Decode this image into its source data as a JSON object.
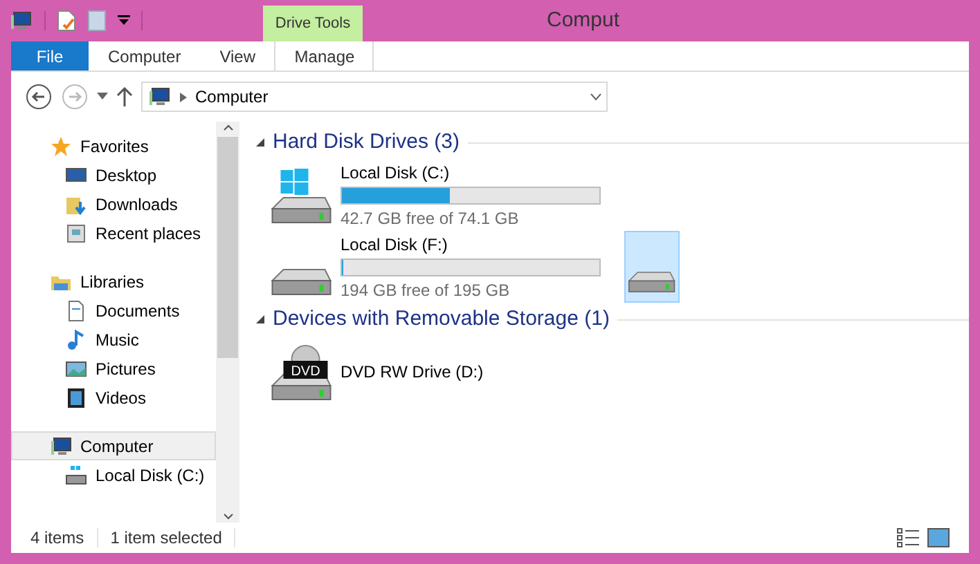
{
  "window": {
    "title": "Comput"
  },
  "context_tab": {
    "label": "Drive Tools"
  },
  "tabs": [
    {
      "label": "File",
      "kind": "file",
      "selected": false
    },
    {
      "label": "Computer",
      "kind": "tab",
      "selected": false
    },
    {
      "label": "View",
      "kind": "tab",
      "selected": false
    },
    {
      "label": "Manage",
      "kind": "context",
      "selected": false
    }
  ],
  "address": {
    "path": "Computer"
  },
  "sidebar": {
    "items": [
      {
        "label": "Favorites",
        "kind": "star",
        "selected": false,
        "children": [
          {
            "label": "Desktop",
            "kind": "desktop",
            "selected": false
          },
          {
            "label": "Downloads",
            "kind": "downloads",
            "selected": false
          },
          {
            "label": "Recent places",
            "kind": "recent",
            "selected": false
          }
        ]
      },
      {
        "label": "Libraries",
        "kind": "library",
        "selected": false,
        "children": [
          {
            "label": "Documents",
            "kind": "document",
            "selected": false
          },
          {
            "label": "Music",
            "kind": "music",
            "selected": false
          },
          {
            "label": "Pictures",
            "kind": "picture",
            "selected": false
          },
          {
            "label": "Videos",
            "kind": "video",
            "selected": false
          }
        ]
      },
      {
        "label": "Computer",
        "kind": "computer",
        "selected": true,
        "children": [
          {
            "label": "Local Disk (C:)",
            "kind": "disk",
            "selected": false
          }
        ]
      }
    ]
  },
  "groups": [
    {
      "title": "Hard Disk Drives (3)",
      "expanded": true,
      "drives": [
        {
          "kind": "system",
          "name": "Local Disk (C:)",
          "level": 0.42,
          "reading": "42.7 GB free of 74.1 GB",
          "selected": false
        },
        {
          "kind": "disk",
          "name": "Local Disk (F:)",
          "level": 0.005,
          "reading": "194 GB free of 195 GB",
          "selected": false
        },
        {
          "kind": "disk",
          "selected": true
        }
      ]
    },
    {
      "title": "Devices with Removable Storage (1)",
      "expanded": true,
      "drives": [
        {
          "kind": "dvd",
          "name": "DVD RW Drive (D:)",
          "icon_text": "DVD",
          "selected": false
        }
      ]
    }
  ],
  "status_bar": {
    "count": "4 items",
    "selection": "1 item selected"
  }
}
